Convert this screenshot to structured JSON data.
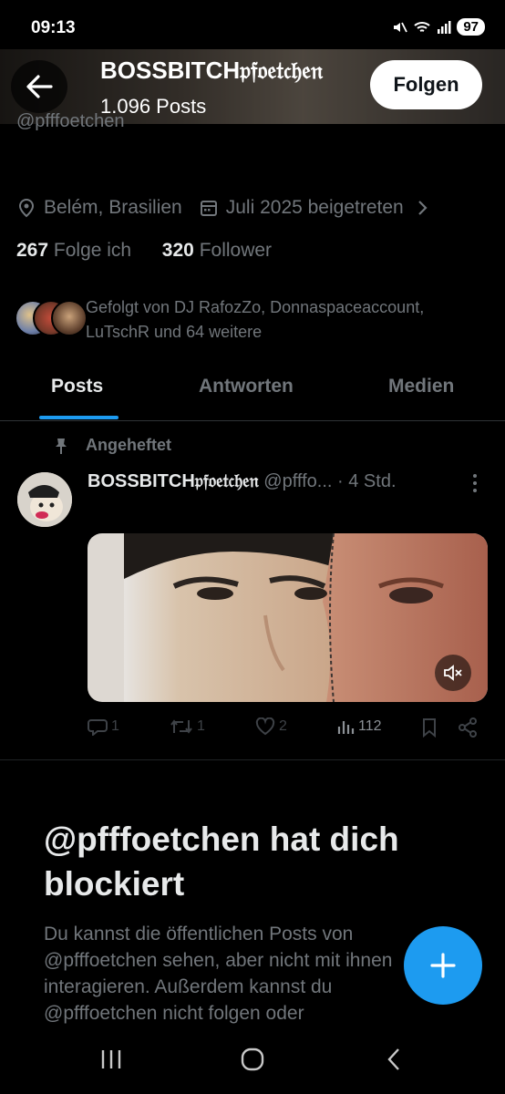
{
  "status_bar": {
    "time": "09:13",
    "battery": "97",
    "icons": [
      "mute-icon",
      "wifi-icon",
      "signal-icon",
      "battery-icon"
    ]
  },
  "header": {
    "display_name": "BOSSBITCH𝔭𝔣𝔬𝔢𝔱𝔠𝔥𝔢𝔫",
    "post_count": "1.096 Posts",
    "follow_label": "Folgen",
    "handle_peek": "@pfffoetchen"
  },
  "profile": {
    "location": "Belém, Brasilien",
    "joined": "Juli 2025 beigetreten",
    "following_count": "267",
    "following_label": "Folge ich",
    "followers_count": "320",
    "followers_label": "Follower",
    "followed_by": "Gefolgt von DJ RafozZo, Donnaspaceaccount, LuTschR und 64 weitere"
  },
  "tabs": [
    {
      "label": "Posts",
      "active": true
    },
    {
      "label": "Antworten",
      "active": false
    },
    {
      "label": "Medien",
      "active": false
    }
  ],
  "post": {
    "pinned_label": "Angeheftet",
    "author": "BOSSBITCH𝔭𝔣𝔬𝔢𝔱𝔠𝔥𝔢𝔫",
    "handle": "@pfffo...",
    "time": "· 4 Std.",
    "replies": "1",
    "reposts": "1",
    "likes": "2",
    "views": "112"
  },
  "blocked": {
    "title": "@pfffoetchen hat dich blockiert",
    "text": "Du kannst die öffentlichen Posts von @pfffoetchen sehen, aber nicht mit ihnen interagieren. Außerdem kannst du @pfffoetchen nicht folgen oder"
  },
  "colors": {
    "accent": "#1d9bf0",
    "muted": "#71767b",
    "text": "#e7e9ea",
    "background": "#000000"
  }
}
